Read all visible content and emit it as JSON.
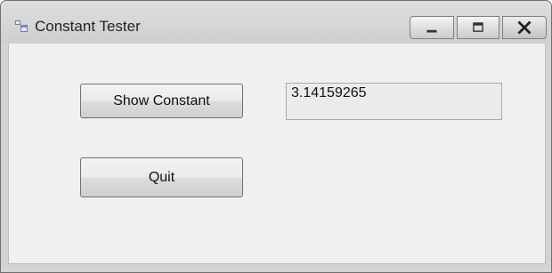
{
  "window": {
    "title": "Constant Tester"
  },
  "buttons": {
    "show_constant": "Show Constant",
    "quit": "Quit"
  },
  "output": {
    "value": "3.14159265"
  },
  "icons": {
    "app": "form-icon",
    "minimize": "minimize-icon",
    "maximize": "maximize-icon",
    "close": "close-icon"
  }
}
